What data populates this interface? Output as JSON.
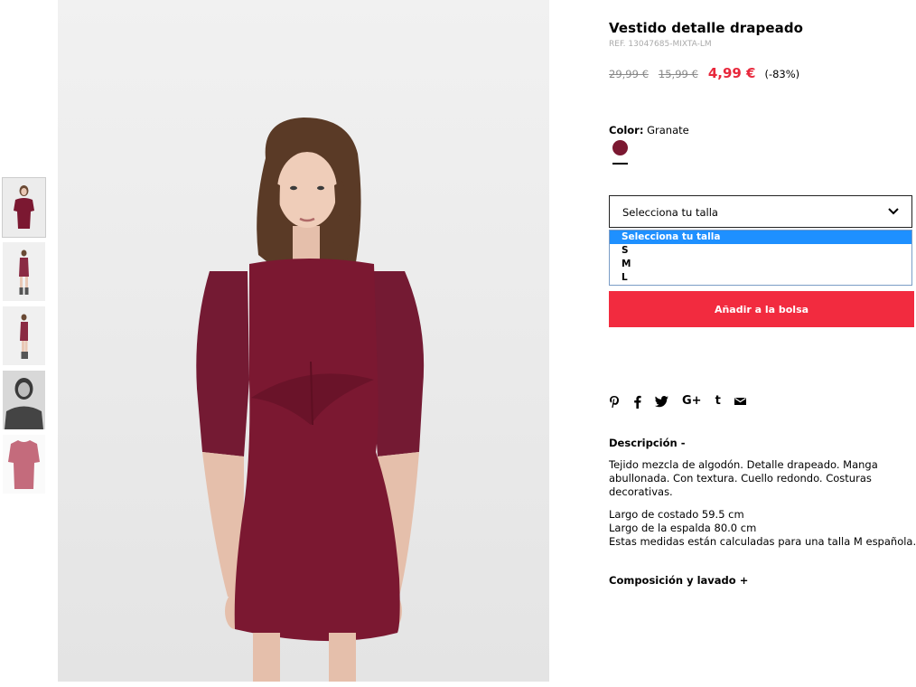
{
  "product": {
    "title": "Vestido detalle drapeado",
    "ref": "REF. 13047685-MIXTA-LM",
    "price_original": "29,99 €",
    "price_previous": "15,99 €",
    "price_current": "4,99 €",
    "discount": "(-83%)"
  },
  "color": {
    "label": "Color:",
    "value": "Granate",
    "swatch_hex": "#7b1831"
  },
  "size_select": {
    "selected": "Selecciona tu talla",
    "options": [
      "Selecciona tu talla",
      "S",
      "M",
      "L"
    ]
  },
  "add_button": {
    "label": "Añadir a la bolsa",
    "color": "#f22b3f"
  },
  "social": {
    "icons": [
      "pinterest-icon",
      "facebook-icon",
      "twitter-icon",
      "google-plus-icon",
      "tumblr-icon",
      "email-icon"
    ],
    "google_plus_label": "G+",
    "tumblr_label": "t"
  },
  "description": {
    "heading": "Descripción -",
    "text": "Tejido mezcla de algodón. Detalle drapeado. Manga abullonada. Con textura. Cuello redondo. Costuras decorativas.",
    "measures": [
      "Largo de costado 59.5 cm",
      "Largo de la espalda 80.0 cm",
      "Estas medidas están calculadas para una talla M española."
    ]
  },
  "composition": {
    "heading": "Composición y lavado +"
  }
}
